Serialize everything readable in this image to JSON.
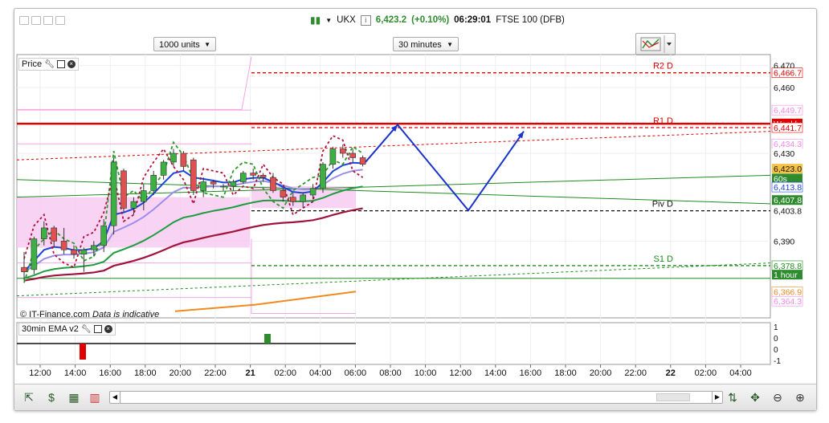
{
  "header": {
    "symbol": "UKX",
    "price": "6,423.2",
    "change": "(+0.10%)",
    "time": "06:29:01",
    "instrument": "FTSE 100 (DFB)"
  },
  "controls": {
    "units": "1000 units",
    "interval": "30 minutes"
  },
  "price_panel": {
    "label": "Price"
  },
  "indicator_panel": {
    "label": "30min EMA v2"
  },
  "copyright": {
    "site": "© IT-Finance.com",
    "note": "Data is indicative"
  },
  "colors": {
    "up_candle": "#3cb043",
    "down_candle": "#e05050",
    "resistance": "#dd0000",
    "support_green": "#1e8c1e",
    "blue_arrow": "#1a33cc",
    "ema_blue": "#1a44dd",
    "ema_green": "#1e9c3e",
    "ema_maroon": "#a0143c",
    "orange": "#f08a1e",
    "pink_band": "#f8c8f0"
  },
  "chart_data": {
    "type": "candlestick",
    "x_ticks": [
      "12:00",
      "14:00",
      "16:00",
      "18:00",
      "20:00",
      "22:00",
      "21",
      "02:00",
      "04:00",
      "06:00",
      "08:00",
      "10:00",
      "12:00",
      "14:00",
      "16:00",
      "18:00",
      "20:00",
      "22:00",
      "22",
      "02:00",
      "04:00"
    ],
    "y_ticks": [
      6470,
      6460,
      6430,
      6390
    ],
    "y_range": [
      6355,
      6475
    ],
    "candles": [
      {
        "o": 6378,
        "h": 6385,
        "l": 6372,
        "c": 6376
      },
      {
        "o": 6377,
        "h": 6392,
        "l": 6375,
        "c": 6391
      },
      {
        "o": 6391,
        "h": 6399,
        "l": 6388,
        "c": 6396
      },
      {
        "o": 6396,
        "h": 6397,
        "l": 6387,
        "c": 6390
      },
      {
        "o": 6390,
        "h": 6396,
        "l": 6384,
        "c": 6386
      },
      {
        "o": 6386,
        "h": 6388,
        "l": 6382,
        "c": 6384
      },
      {
        "o": 6384,
        "h": 6387,
        "l": 6376,
        "c": 6386
      },
      {
        "o": 6386,
        "h": 6390,
        "l": 6383,
        "c": 6388
      },
      {
        "o": 6388,
        "h": 6400,
        "l": 6385,
        "c": 6397
      },
      {
        "o": 6397,
        "h": 6428,
        "l": 6393,
        "c": 6426
      },
      {
        "o": 6422,
        "h": 6423,
        "l": 6403,
        "c": 6405
      },
      {
        "o": 6405,
        "h": 6410,
        "l": 6402,
        "c": 6408
      },
      {
        "o": 6408,
        "h": 6416,
        "l": 6404,
        "c": 6413
      },
      {
        "o": 6413,
        "h": 6422,
        "l": 6411,
        "c": 6420
      },
      {
        "o": 6420,
        "h": 6427,
        "l": 6418,
        "c": 6426
      },
      {
        "o": 6426,
        "h": 6432,
        "l": 6424,
        "c": 6430
      },
      {
        "o": 6430,
        "h": 6431,
        "l": 6422,
        "c": 6424
      },
      {
        "o": 6427,
        "h": 6428,
        "l": 6411,
        "c": 6413
      },
      {
        "o": 6413,
        "h": 6419,
        "l": 6410,
        "c": 6417
      },
      {
        "o": 6417,
        "h": 6418,
        "l": 6414,
        "c": 6416
      },
      {
        "o": 6415,
        "h": 6416,
        "l": 6413,
        "c": 6415
      },
      {
        "o": 6415,
        "h": 6418,
        "l": 6413,
        "c": 6417
      },
      {
        "o": 6417,
        "h": 6422,
        "l": 6416,
        "c": 6421
      },
      {
        "o": 6421,
        "h": 6423,
        "l": 6418,
        "c": 6420
      },
      {
        "o": 6420,
        "h": 6421,
        "l": 6417,
        "c": 6419
      },
      {
        "o": 6419,
        "h": 6421,
        "l": 6412,
        "c": 6413
      },
      {
        "o": 6413,
        "h": 6414,
        "l": 6408,
        "c": 6410
      },
      {
        "o": 6410,
        "h": 6412,
        "l": 6406,
        "c": 6408
      },
      {
        "o": 6408,
        "h": 6412,
        "l": 6405,
        "c": 6411
      },
      {
        "o": 6411,
        "h": 6416,
        "l": 6409,
        "c": 6414
      },
      {
        "o": 6414,
        "h": 6426,
        "l": 6412,
        "c": 6425
      },
      {
        "o": 6425,
        "h": 6433,
        "l": 6423,
        "c": 6432
      },
      {
        "o": 6432,
        "h": 6434,
        "l": 6428,
        "c": 6430
      },
      {
        "o": 6430,
        "h": 6432,
        "l": 6426,
        "c": 6428
      },
      {
        "o": 6428,
        "h": 6429,
        "l": 6424,
        "c": 6425
      }
    ],
    "levels": [
      {
        "label": "R2 D",
        "value": 6466.7,
        "color": "#dd0000",
        "style": "dashed"
      },
      {
        "label": "R1 D",
        "value": 6441.7,
        "color": "#dd0000",
        "style": "dashed"
      },
      {
        "label": "Weekly",
        "value": 6443.5,
        "color": "#dd0000",
        "style": "solid"
      },
      {
        "label": "Piv D",
        "value": 6403.8,
        "color": "#111111",
        "style": "dashed"
      },
      {
        "label": "S1 D",
        "value": 6378.8,
        "color": "#1e8c1e",
        "style": "dashed"
      }
    ],
    "right_labels": [
      {
        "text": "6,470",
        "value": 6470,
        "bg": "#ffffff",
        "fg": "#111111"
      },
      {
        "text": "6,466.7",
        "value": 6466.7,
        "bg": "#ffffff",
        "fg": "#dd0000"
      },
      {
        "text": "6,460",
        "value": 6460,
        "bg": "#ffffff",
        "fg": "#111111"
      },
      {
        "text": "6,449.7",
        "value": 6449.7,
        "bg": "#ffffff",
        "fg": "#f08ae6"
      },
      {
        "text": "Weekly",
        "value": 6443.6,
        "bg": "#dd0000",
        "fg": "#ffffff"
      },
      {
        "text": "6,441.7",
        "value": 6441.7,
        "bg": "#ffffff",
        "fg": "#dd0000"
      },
      {
        "text": "6,434.3",
        "value": 6434.3,
        "bg": "#ffffff",
        "fg": "#f08ae6"
      },
      {
        "text": "6,430",
        "value": 6430,
        "bg": "#ffffff",
        "fg": "#111111"
      },
      {
        "text": "6,423.0",
        "value": 6423,
        "bg": "#f5c242",
        "fg": "#111111"
      },
      {
        "text": "60s",
        "value": 6418.5,
        "bg": "#2e8b2e",
        "fg": "#ffffff"
      },
      {
        "text": "6,413.8",
        "value": 6414.6,
        "bg": "#ffffff",
        "fg": "#1a44dd"
      },
      {
        "text": "6,407.8",
        "value": 6408.7,
        "bg": "#2e8b2e",
        "fg": "#ffffff"
      },
      {
        "text": "6,403.8",
        "value": 6403.8,
        "bg": "#ffffff",
        "fg": "#111111"
      },
      {
        "text": "6,390",
        "value": 6390,
        "bg": "#ffffff",
        "fg": "#111111"
      },
      {
        "text": "6,378.8",
        "value": 6378.8,
        "bg": "#ffffff",
        "fg": "#1e8c1e"
      },
      {
        "text": "1 hour",
        "value": 6374.7,
        "bg": "#2e8b2e",
        "fg": "#ffffff"
      },
      {
        "text": "6,366.9",
        "value": 6366.9,
        "bg": "#ffffff",
        "fg": "#f08a1e"
      },
      {
        "text": "6,364.3",
        "value": 6362.6,
        "bg": "#ffffff",
        "fg": "#f08ae6"
      }
    ],
    "indicator": {
      "y_ticks": [
        "1",
        "0",
        "0",
        "-1"
      ],
      "bars": [
        {
          "index": 19,
          "value": 1,
          "color": "#2e8b2e"
        },
        {
          "index": 4,
          "value": -1,
          "color": "#dd0000"
        }
      ]
    }
  }
}
